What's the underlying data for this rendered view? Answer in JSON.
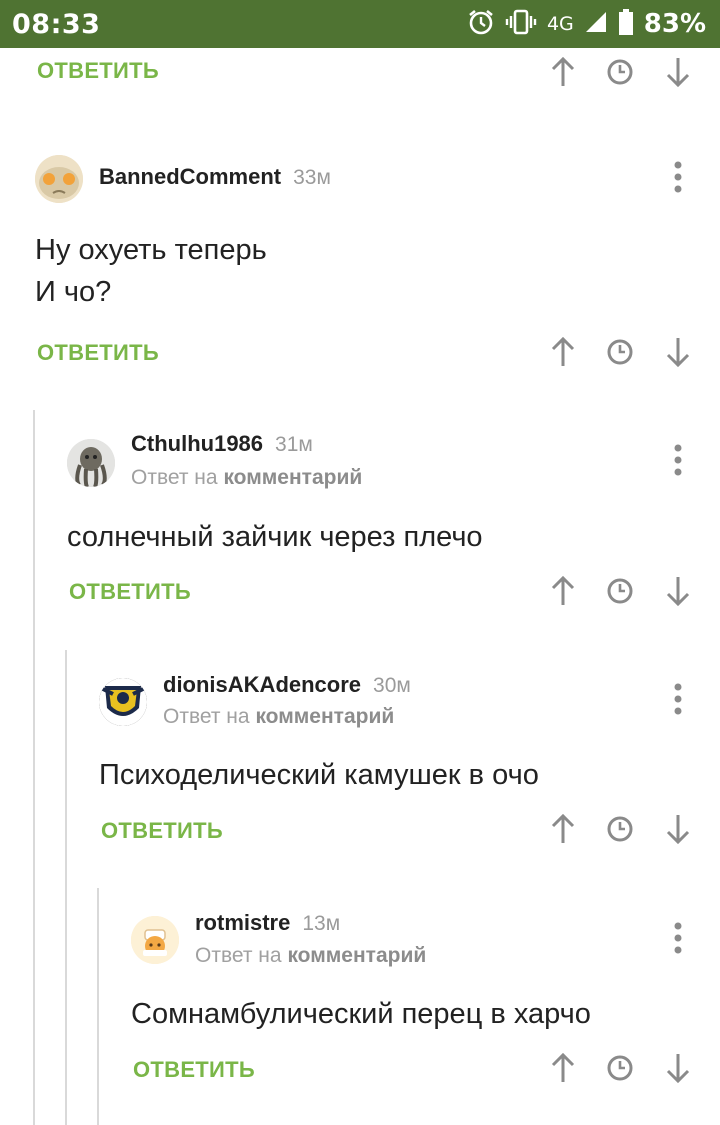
{
  "status_bar": {
    "time": "08:33",
    "network": "4G",
    "battery": "83%",
    "bg_color": "#4f7332"
  },
  "reply_label": "ОТВЕТИТЬ",
  "reply_to_prefix": "Ответ на",
  "reply_to_link": "комментарий",
  "comments": [
    {
      "author": "BannedComment",
      "time": "33м",
      "lines": [
        "Ну охуеть теперь",
        "И чо?"
      ]
    },
    {
      "author": "Cthulhu1986",
      "time": "31м",
      "lines": [
        "солнечный зайчик через плечо"
      ]
    },
    {
      "author": "dionisAKAdencore",
      "time": "30м",
      "lines": [
        "Психоделический камушек в очо"
      ]
    },
    {
      "author": "rotmistre",
      "time": "13м",
      "lines": [
        "Сомнамбулический перец в харчо"
      ]
    }
  ],
  "icons": {
    "up": "arrow-up-icon",
    "clock": "clock-icon",
    "down": "arrow-down-icon",
    "more": "more-vertical-icon"
  },
  "colors": {
    "accent_green": "#7ab648",
    "meta_gray": "#9a9a9a",
    "icon_gray": "#8a8a8a"
  }
}
